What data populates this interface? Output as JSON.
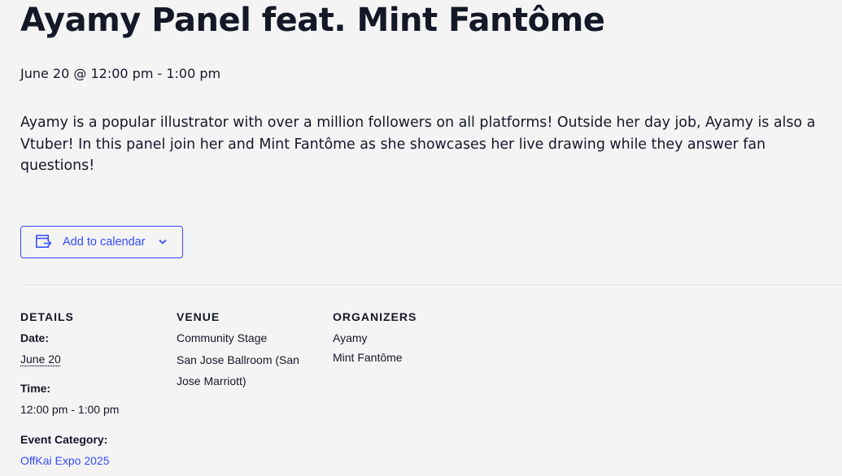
{
  "event": {
    "title": "Ayamy Panel feat. Mint Fantôme",
    "datetime": "June 20 @ 12:00 pm - 1:00 pm",
    "description": "Ayamy is a popular illustrator with over a million followers on all platforms! Outside her day job, Ayamy is also a Vtuber! In this panel join her and Mint Fantôme as she showcases her live drawing while they answer fan questions!"
  },
  "calendar_button": {
    "label": "Add to calendar",
    "icon": "calendar-export-icon",
    "chevron": "chevron-down-icon"
  },
  "details": {
    "heading": "DETAILS",
    "date_label": "Date:",
    "date_value": "June 20",
    "time_label": "Time:",
    "time_value": "12:00 pm - 1:00 pm",
    "category_label": "Event Category:",
    "category_value": "OffKai Expo 2025"
  },
  "venue": {
    "heading": "VENUE",
    "name": "Community Stage",
    "address_line1": "San Jose Ballroom (San",
    "address_line2": "Jose Marriott)"
  },
  "organizers": {
    "heading": "ORGANIZERS",
    "items": [
      "Ayamy",
      "Mint Fantôme"
    ]
  },
  "colors": {
    "background": "#f5f4f5",
    "text": "#141827",
    "accent": "#334aff",
    "divider": "#e3e3e6"
  }
}
